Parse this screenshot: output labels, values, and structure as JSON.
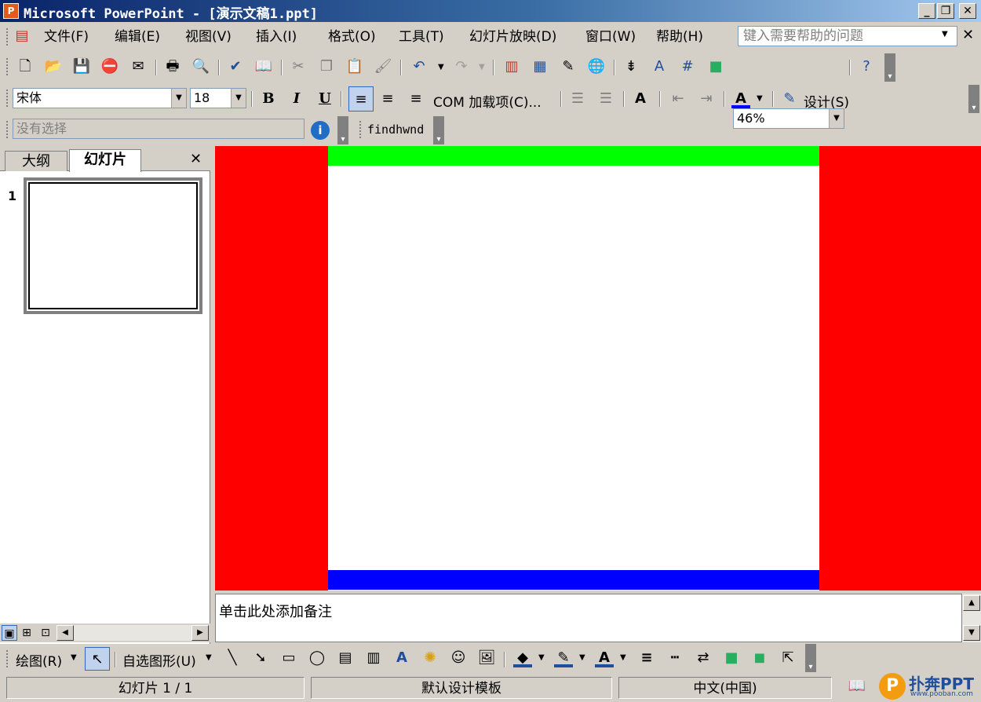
{
  "window": {
    "title": "Microsoft PowerPoint - [演示文稿1.ppt]",
    "minimize_label": "_",
    "restore_label": "❐",
    "close_label": "✕"
  },
  "menu": {
    "items": [
      "文件(F)",
      "编辑(E)",
      "视图(V)",
      "插入(I)",
      "格式(O)",
      "工具(T)",
      "幻灯片放映(D)",
      "窗口(W)",
      "帮助(H)"
    ],
    "help_placeholder": "键入需要帮助的问题",
    "close_label": "✕"
  },
  "standard_toolbar": {
    "zoom": "46%"
  },
  "formatting_toolbar": {
    "font": "宋体",
    "size": "18",
    "bold": "B",
    "italic": "I",
    "underline": "U",
    "com_label": "COM 加载项(C)...",
    "design_label": "设计(S)"
  },
  "selection_bar": {
    "placeholder": "没有选择",
    "findhwnd_label": "findhwnd"
  },
  "left_panel": {
    "tab_outline": "大纲",
    "tab_slides": "幻灯片",
    "close_label": "✕",
    "slide_number": "1"
  },
  "slide": {
    "background_color": "#ff0000",
    "top_band_color": "#00ff00",
    "bottom_band_color": "#0000ff"
  },
  "notes": {
    "placeholder": "单击此处添加备注"
  },
  "drawing_toolbar": {
    "draw_label": "绘图(R)",
    "autoshapes_label": "自选图形(U)"
  },
  "statusbar": {
    "slide_count": "幻灯片 1 / 1",
    "template": "默认设计模板",
    "language": "中文(中国)"
  },
  "logo": {
    "text": "扑奔PPT",
    "url": "www.pooban.com"
  }
}
